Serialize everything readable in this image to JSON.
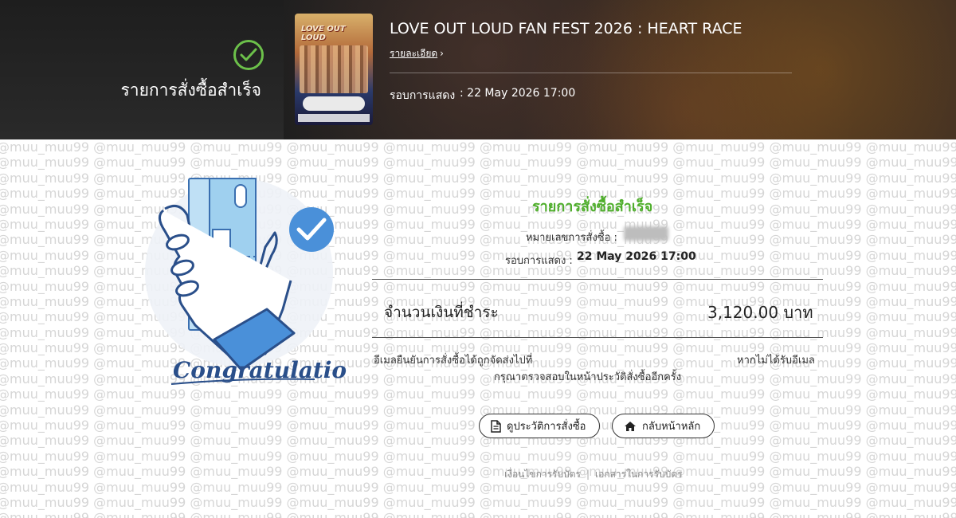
{
  "banner": {
    "status_text": "รายการสั่งซื้อสำเร็จ",
    "event_title": "LOVE OUT LOUD FAN FEST 2026 : HEART RACE",
    "details_link": "รายละเอียด",
    "showtime_label": "รอบการแสดง",
    "showtime_value": ": 22 May 2026 17:00"
  },
  "poster": {
    "title": "LOVE OUT LOUD"
  },
  "illustration": {
    "caption": "Congratulations"
  },
  "watermark": {
    "text": "@muu_muu99"
  },
  "summary": {
    "title": "รายการสั่งซื้อสำเร็จ",
    "order_number_label": "หมายเลขการสั่งซื้อ :",
    "order_number_value": "muu99",
    "showtime_label": "รอบการแสดง :",
    "showtime_value": "22 May 2026 17:00",
    "amount_label": "จำนวนเงินที่ชำระ",
    "amount_value": "3,120.00 บาท",
    "email_left": "อีเมลยืนยันการสั่งซื้อได้ถูกจัดส่งไปที่",
    "email_right": "หากไม่ได้รับอีเมล",
    "email_line2": "กรุณาตรวจสอบในหน้าประวัติสั่งซื้ออีกครั้ง"
  },
  "buttons": {
    "history_label": "ดูประวัติการสั่งซื้อ",
    "home_label": "กลับหน้าหลัก"
  },
  "footer": {
    "terms_label": "เงื่อนไขการรับบัตร",
    "docs_label": "เอกสารในการรับบัตร"
  },
  "colors": {
    "accent_green": "#4fae2c",
    "check_blue": "#4a90d9"
  }
}
